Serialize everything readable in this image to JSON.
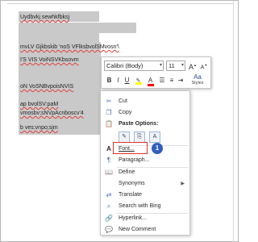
{
  "document": {
    "lines": [
      "Uydbvkj sewhkfbksj",
      "mvLV Gjkbskib 'noS VFlksbvolSMvosn'\\",
      "I'S VIS VoiNSVKbsovm",
      "oN VoSNBvpoisNVIS",
      "ap bvolSV:paM",
      "vmosbv;sNVpAcnboscv'4",
      "b ves:vnpo;sjm"
    ]
  },
  "mini_toolbar": {
    "font_name": "Calibri (Body)",
    "font_size": "11",
    "grow_font": "A",
    "shrink_font": "A",
    "bold": "B",
    "italic": "I",
    "underline": "U",
    "styles_label": "Styles",
    "colors": {
      "highlight": "#ffff00",
      "font_color": "#ff0000"
    }
  },
  "context_menu": {
    "items": [
      {
        "label": "Cut",
        "icon": "scissors-icon"
      },
      {
        "label": "Copy",
        "icon": "copy-icon"
      },
      {
        "label": "Paste Options:",
        "icon": "paste-icon"
      },
      {
        "label": "Font...",
        "icon": "font-icon"
      },
      {
        "label": "Paragraph...",
        "icon": "paragraph-icon"
      },
      {
        "label": "Define",
        "icon": "define-icon"
      },
      {
        "label": "Synonyms",
        "icon": ""
      },
      {
        "label": "Translate",
        "icon": "translate-icon"
      },
      {
        "label": "Search with Bing",
        "icon": "search-icon"
      },
      {
        "label": "Hyperlink...",
        "icon": "hyperlink-icon"
      },
      {
        "label": "New Comment",
        "icon": "comment-icon"
      }
    ]
  },
  "annotation": {
    "badge_number": "1",
    "highlight_color": "#e03030",
    "badge_color": "#2f5fbf"
  }
}
